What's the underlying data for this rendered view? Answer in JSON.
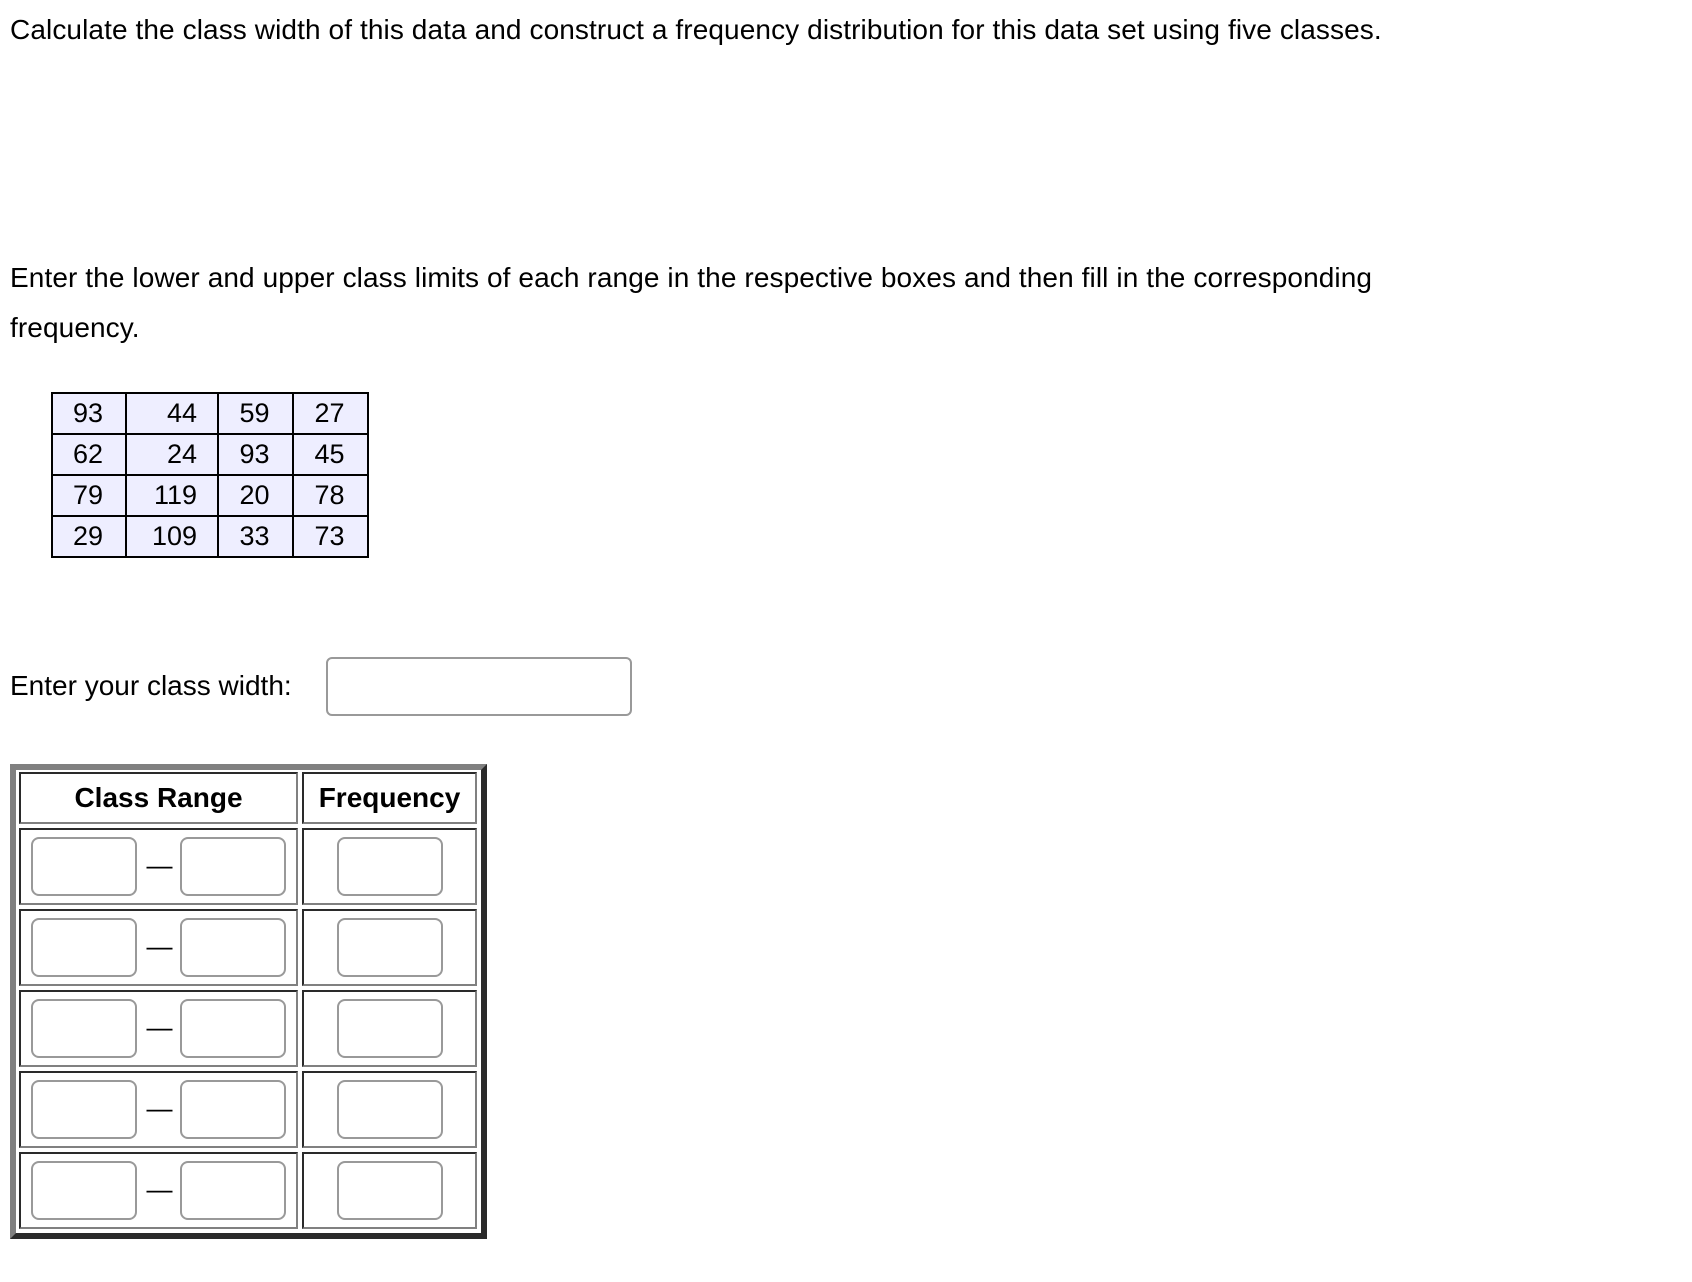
{
  "instructions": {
    "paragraph1": "Calculate the class width of this data and construct a frequency distribution for this data set using five classes.",
    "paragraph2": "Enter the lower and upper class limits of each range in the respective boxes and then fill in the corresponding frequency."
  },
  "data_table": {
    "rows": [
      [
        "93",
        "44",
        "59",
        "27"
      ],
      [
        "62",
        "24",
        "93",
        "45"
      ],
      [
        "79",
        "119",
        "20",
        "78"
      ],
      [
        "29",
        "109",
        "33",
        "73"
      ]
    ],
    "background_color": "#eeeeff"
  },
  "class_width": {
    "label": "Enter your class width:",
    "value": "",
    "placeholder": ""
  },
  "frequency_table": {
    "headers": {
      "class_range": "Class Range",
      "frequency": "Frequency"
    },
    "separator": "—",
    "rows": [
      {
        "lower": "",
        "upper": "",
        "frequency": ""
      },
      {
        "lower": "",
        "upper": "",
        "frequency": ""
      },
      {
        "lower": "",
        "upper": "",
        "frequency": ""
      },
      {
        "lower": "",
        "upper": "",
        "frequency": ""
      },
      {
        "lower": "",
        "upper": "",
        "frequency": ""
      }
    ]
  }
}
